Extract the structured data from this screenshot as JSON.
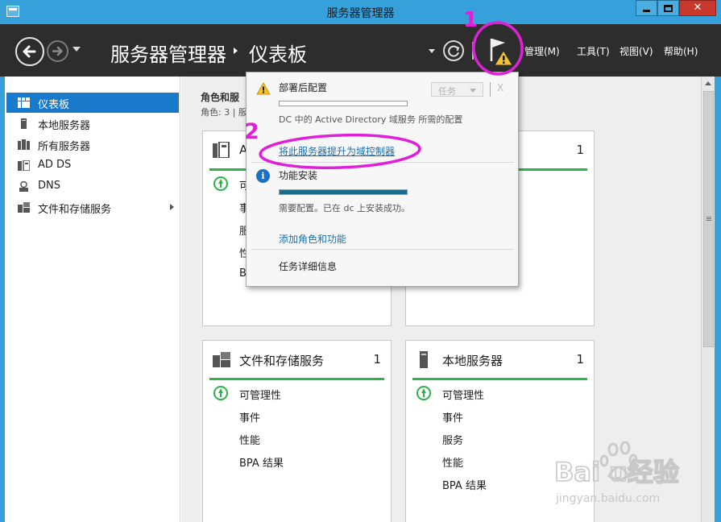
{
  "window": {
    "title": "服务器管理器"
  },
  "header": {
    "breadcrumb_root": "服务器管理器",
    "breadcrumb_page": "仪表板",
    "menu": [
      {
        "label": "管理(M)"
      },
      {
        "label": "工具(T)"
      },
      {
        "label": "视图(V)"
      },
      {
        "label": "帮助(H)"
      }
    ]
  },
  "sidebar": {
    "items": [
      {
        "label": "仪表板",
        "icon": "dashboard-icon",
        "active": true
      },
      {
        "label": "本地服务器",
        "icon": "server-icon"
      },
      {
        "label": "所有服务器",
        "icon": "servers-icon"
      },
      {
        "label": "AD DS",
        "icon": "ad-ds-icon"
      },
      {
        "label": "DNS",
        "icon": "dns-icon"
      },
      {
        "label": "文件和存储服务",
        "icon": "file-storage-icon",
        "expandable": true
      }
    ]
  },
  "main": {
    "roles_title": "角色和服",
    "roles_count": "角色: 3 | 服",
    "tiles": [
      {
        "name": "A",
        "count": "1",
        "rows": [
          "可",
          "事",
          "服",
          "性",
          "B"
        ]
      },
      {
        "name": "",
        "count": "1",
        "rows": []
      },
      {
        "name": "文件和存储服务",
        "count": "1",
        "rows": [
          "可管理性",
          "事件",
          "性能",
          "BPA 结果"
        ]
      },
      {
        "name": "本地服务器",
        "count": "1",
        "rows": [
          "可管理性",
          "事件",
          "服务",
          "性能",
          "BPA 结果"
        ]
      }
    ]
  },
  "popup": {
    "task1_title": "部署后配置",
    "task1_button": "任务",
    "task1_close": "X",
    "task1_desc": "DC 中的 Active Directory 域服务 所需的配置",
    "task1_link": "将此服务器提升为域控制器",
    "task1_progress": 0.0,
    "task2_title": "功能安装",
    "task2_progress": 1.0,
    "task2_desc": "需要配置。已在 dc 上安装成功。",
    "task2_link": "添加角色和功能",
    "details_link": "任务详细信息"
  },
  "annotations": {
    "marker1": "1",
    "marker2": "2",
    "color": "#e020d8"
  },
  "watermark": {
    "brand": "Baidu经验",
    "url": "jingyan.baidu.com"
  },
  "colors": {
    "titlebar": "#35a0d9",
    "header": "#2d2d2d",
    "selection": "#1979ca",
    "status_green": "#2eb24a",
    "warning_yellow": "#f5c22b",
    "link": "#1e6fa8"
  }
}
